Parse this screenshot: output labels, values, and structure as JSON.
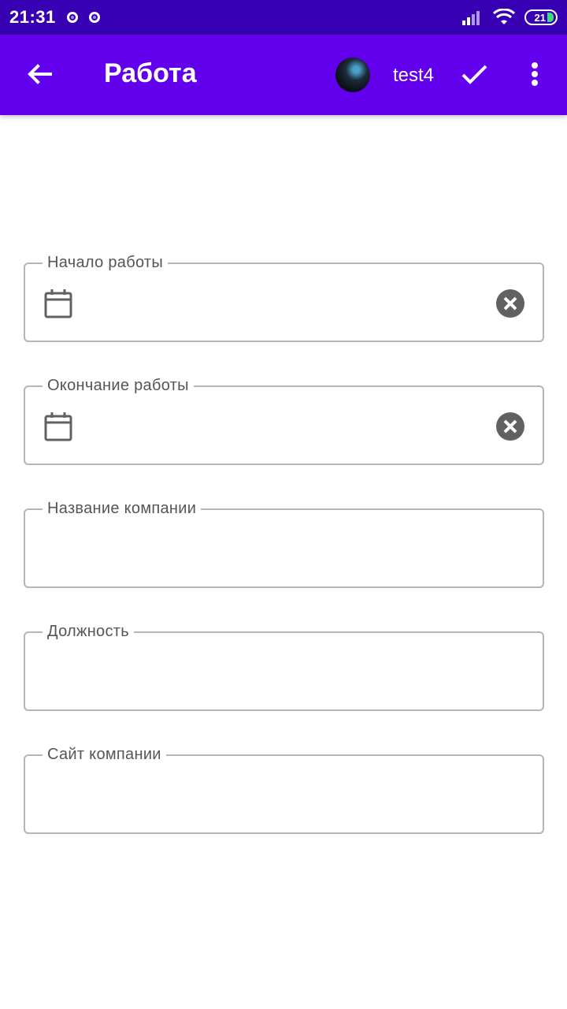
{
  "status_bar": {
    "time": "21:31",
    "battery_level": "21"
  },
  "app_bar": {
    "title": "Работа",
    "username": "test4",
    "back_icon": "arrow-back-icon",
    "confirm_icon": "check-icon",
    "more_icon": "more-vert-icon"
  },
  "form": {
    "start_date": {
      "label": "Начало работы",
      "value": ""
    },
    "end_date": {
      "label": "Окончание работы",
      "value": ""
    },
    "company_name": {
      "label": "Название компании",
      "value": ""
    },
    "position": {
      "label": "Должность",
      "value": ""
    },
    "company_site": {
      "label": "Сайт компании",
      "value": ""
    }
  },
  "colors": {
    "status_bar": "#3700b3",
    "app_bar": "#6200ee",
    "field_border": "#b5b5b5",
    "label_text": "#555555"
  }
}
